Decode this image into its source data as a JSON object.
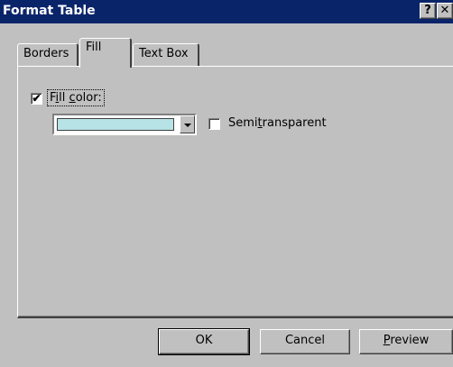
{
  "window": {
    "title": "Format Table",
    "help_label": "?",
    "close_label": "✕"
  },
  "tabs": [
    {
      "label": "Borders"
    },
    {
      "label": "Fill",
      "active": true
    },
    {
      "label": "Text Box"
    }
  ],
  "fill": {
    "fill_color_checked": true,
    "fill_color_label_pre": "F",
    "fill_color_label_u1": "i",
    "fill_color_label_mid": "ll ",
    "fill_color_label_u2": "c",
    "fill_color_label_post": "olor:",
    "color_value": "#b7e3e6",
    "semitransparent_checked": false,
    "semitransparent_label_pre": "Semi",
    "semitransparent_label_u": "t",
    "semitransparent_label_post": "ransparent"
  },
  "buttons": {
    "ok": "OK",
    "cancel": "Cancel",
    "preview_u": "P",
    "preview_rest": "review"
  },
  "colors": {
    "titlebar": "#0a246a",
    "face": "#c0c0c0"
  }
}
